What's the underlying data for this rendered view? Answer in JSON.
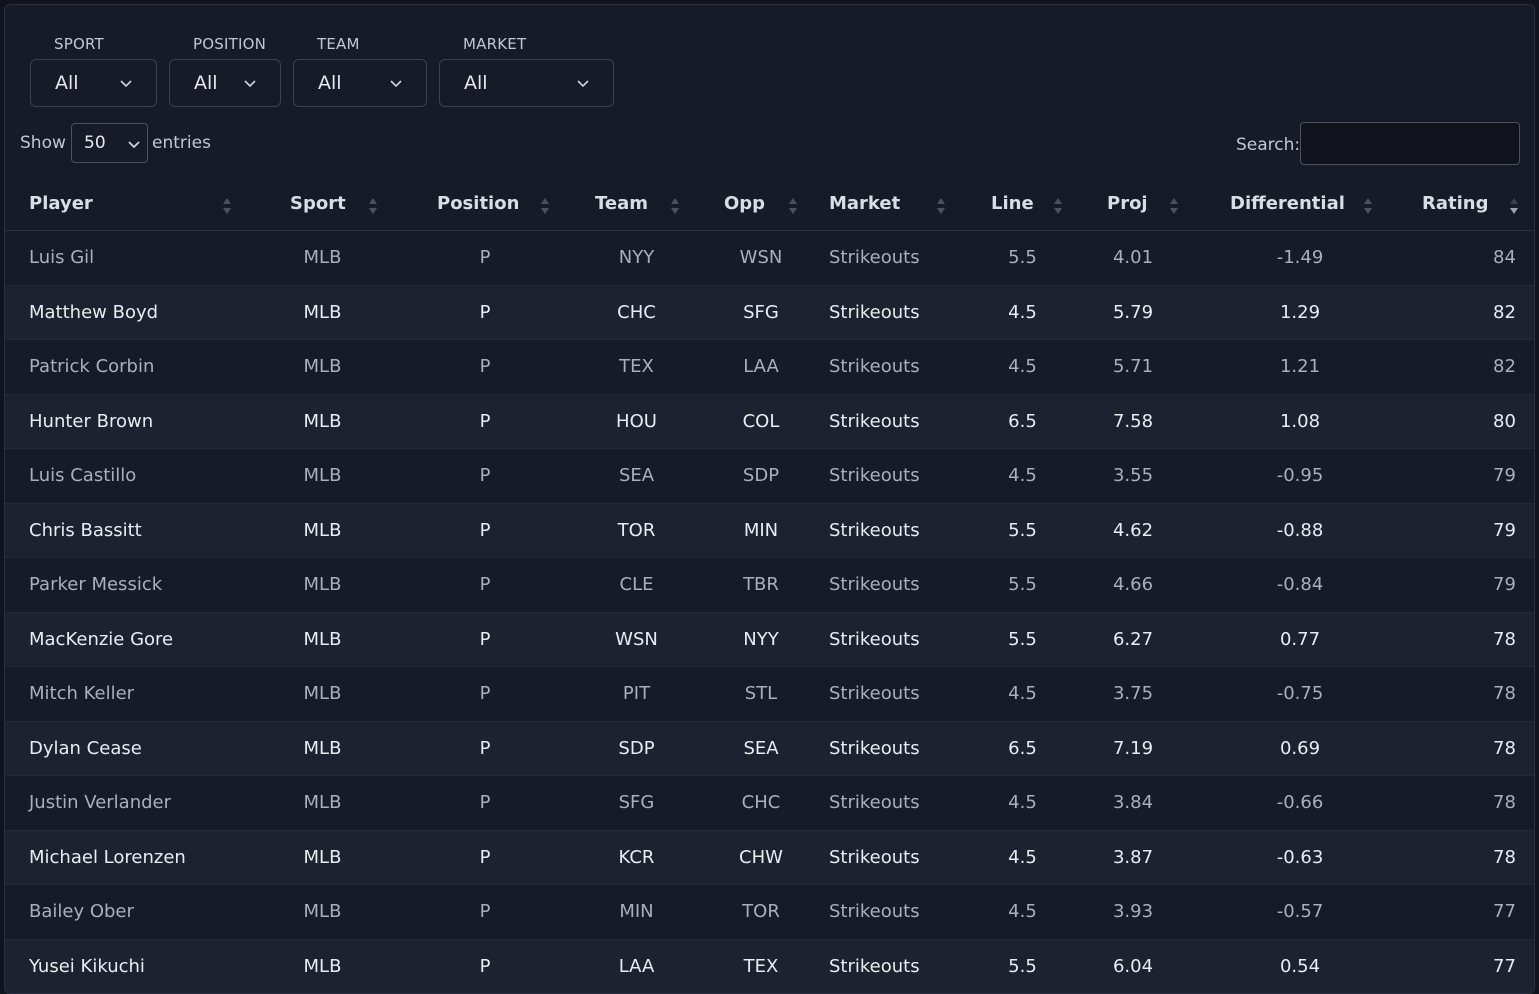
{
  "filters": [
    {
      "label": "SPORT",
      "value": "All"
    },
    {
      "label": "POSITION",
      "value": "All"
    },
    {
      "label": "TEAM",
      "value": "All"
    },
    {
      "label": "MARKET",
      "value": "All"
    }
  ],
  "entries": {
    "show_label": "Show",
    "value": "50",
    "suffix": "entries"
  },
  "search": {
    "label": "Search:",
    "value": ""
  },
  "table": {
    "columns": [
      "Player",
      "Sport",
      "Position",
      "Team",
      "Opp",
      "Market",
      "Line",
      "Proj",
      "Differential",
      "Rating"
    ],
    "sorted_column": "Rating",
    "sort_direction": "descending",
    "rows": [
      [
        "Luis Gil",
        "MLB",
        "P",
        "NYY",
        "WSN",
        "Strikeouts",
        "5.5",
        "4.01",
        "-1.49",
        "84"
      ],
      [
        "Matthew Boyd",
        "MLB",
        "P",
        "CHC",
        "SFG",
        "Strikeouts",
        "4.5",
        "5.79",
        "1.29",
        "82"
      ],
      [
        "Patrick Corbin",
        "MLB",
        "P",
        "TEX",
        "LAA",
        "Strikeouts",
        "4.5",
        "5.71",
        "1.21",
        "82"
      ],
      [
        "Hunter Brown",
        "MLB",
        "P",
        "HOU",
        "COL",
        "Strikeouts",
        "6.5",
        "7.58",
        "1.08",
        "80"
      ],
      [
        "Luis Castillo",
        "MLB",
        "P",
        "SEA",
        "SDP",
        "Strikeouts",
        "4.5",
        "3.55",
        "-0.95",
        "79"
      ],
      [
        "Chris Bassitt",
        "MLB",
        "P",
        "TOR",
        "MIN",
        "Strikeouts",
        "5.5",
        "4.62",
        "-0.88",
        "79"
      ],
      [
        "Parker Messick",
        "MLB",
        "P",
        "CLE",
        "TBR",
        "Strikeouts",
        "5.5",
        "4.66",
        "-0.84",
        "79"
      ],
      [
        "MacKenzie Gore",
        "MLB",
        "P",
        "WSN",
        "NYY",
        "Strikeouts",
        "5.5",
        "6.27",
        "0.77",
        "78"
      ],
      [
        "Mitch Keller",
        "MLB",
        "P",
        "PIT",
        "STL",
        "Strikeouts",
        "4.5",
        "3.75",
        "-0.75",
        "78"
      ],
      [
        "Dylan Cease",
        "MLB",
        "P",
        "SDP",
        "SEA",
        "Strikeouts",
        "6.5",
        "7.19",
        "0.69",
        "78"
      ],
      [
        "Justin Verlander",
        "MLB",
        "P",
        "SFG",
        "CHC",
        "Strikeouts",
        "4.5",
        "3.84",
        "-0.66",
        "78"
      ],
      [
        "Michael Lorenzen",
        "MLB",
        "P",
        "KCR",
        "CHW",
        "Strikeouts",
        "4.5",
        "3.87",
        "-0.63",
        "78"
      ],
      [
        "Bailey Ober",
        "MLB",
        "P",
        "MIN",
        "TOR",
        "Strikeouts",
        "4.5",
        "3.93",
        "-0.57",
        "77"
      ],
      [
        "Yusei Kikuchi",
        "MLB",
        "P",
        "LAA",
        "TEX",
        "Strikeouts",
        "5.5",
        "6.04",
        "0.54",
        "77"
      ]
    ]
  }
}
